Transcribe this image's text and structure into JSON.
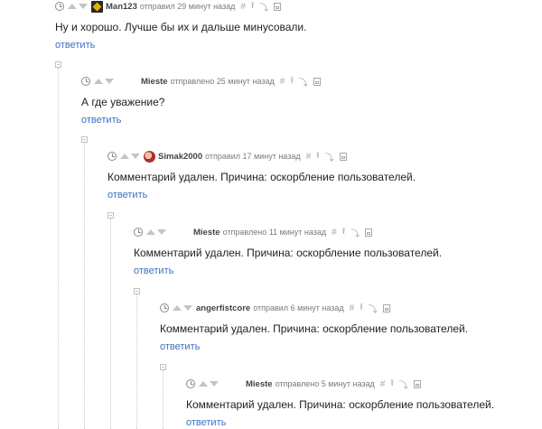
{
  "comments": [
    {
      "nick": "Man123",
      "action": "отправил",
      "time": "29 минут назад",
      "text": "Ну и хорошо. Лучше бы их и дальше минусовали.",
      "reply_label": "ответить",
      "avatar": "man-icon"
    },
    {
      "nick": "Mieste",
      "action": "отправлено",
      "time": "25 минут назад",
      "text": "А где уважение?",
      "reply_label": "ответить",
      "avatar": "none"
    },
    {
      "nick": "Simak2000",
      "action": "отправил",
      "time": "17 минут назад",
      "text": "Комментарий удален. Причина: оскорбление пользователей.",
      "reply_label": "ответить",
      "avatar": "face-icon"
    },
    {
      "nick": "Mieste",
      "action": "отправлено",
      "time": "11 минут назад",
      "text": "Комментарий удален. Причина: оскорбление пользователей.",
      "reply_label": "ответить",
      "avatar": "none"
    },
    {
      "nick": "angerfistcore",
      "action": "отправил",
      "time": "6 минут назад",
      "text": "Комментарий удален. Причина: оскорбление пользователей.",
      "reply_label": "ответить",
      "avatar": "none"
    },
    {
      "nick": "Mieste",
      "action": "отправлено",
      "time": "5 минут назад",
      "text": "Комментарий удален. Причина: оскорбление пользователей.",
      "reply_label": "ответить",
      "avatar": "none"
    }
  ],
  "tool_glyphs": {
    "hash": "#",
    "up": "⭱",
    "branch": "⤵"
  },
  "colors": {
    "link": "#3a72c4",
    "text": "#222222",
    "meta": "#7a7a7a"
  }
}
